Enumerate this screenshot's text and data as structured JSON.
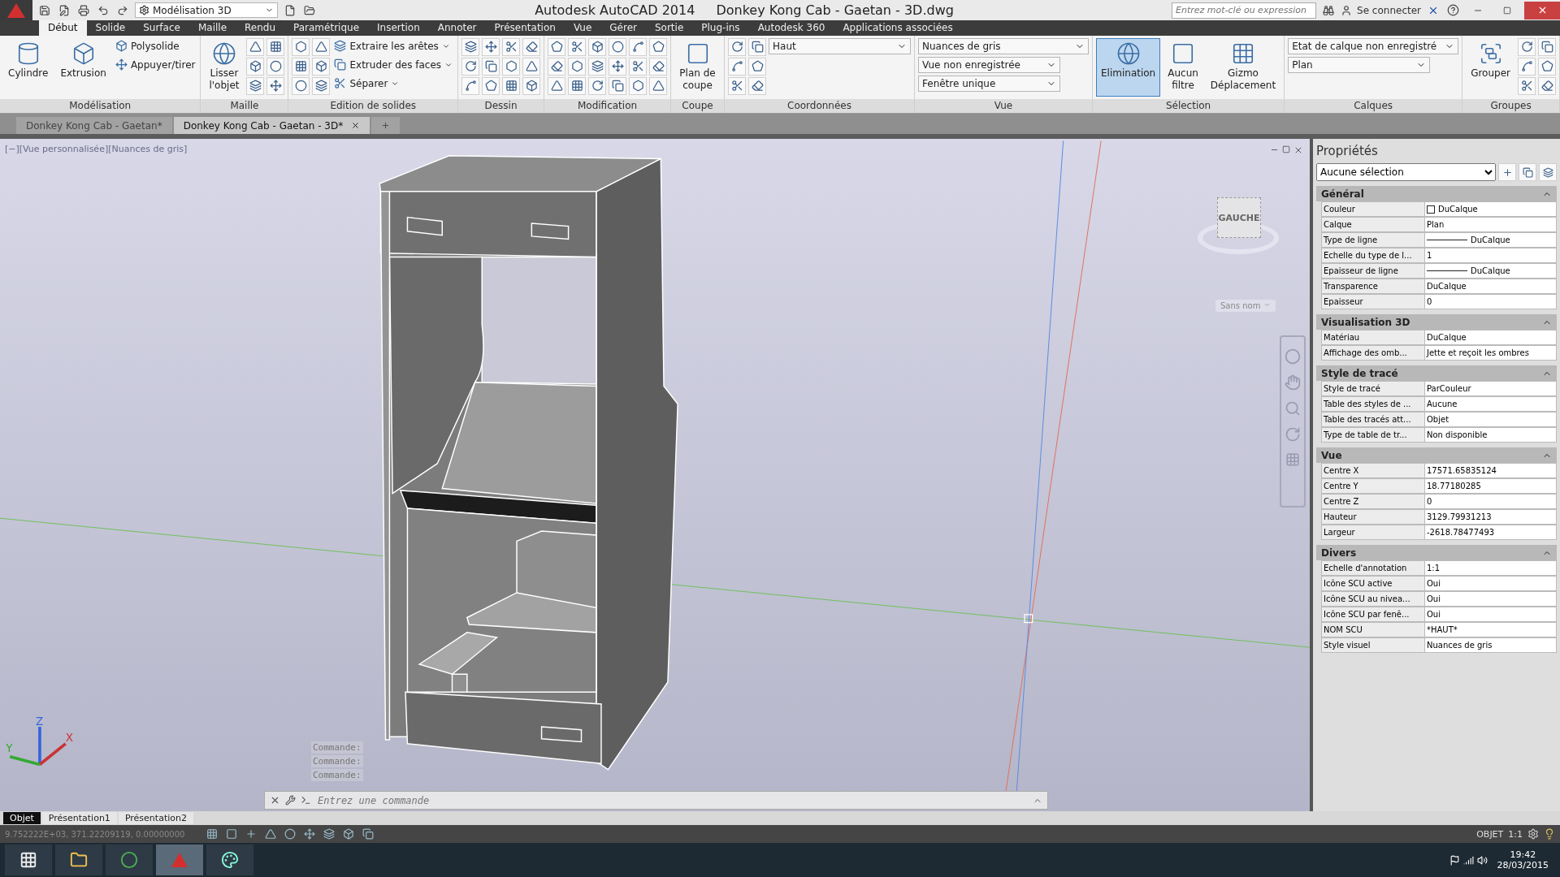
{
  "title_bar": {
    "workspace": "Modélisation 3D",
    "app_name": "Autodesk AutoCAD 2014",
    "file_name": "Donkey Kong Cab - Gaetan - 3D.dwg",
    "search": {
      "placeholder": "Entrez mot-clé ou expression"
    },
    "sign_in": "Se connecter"
  },
  "ribbon_tabs": [
    {
      "label": "Début",
      "selected": true
    },
    {
      "label": "Solide",
      "selected": false
    },
    {
      "label": "Surface",
      "selected": false
    },
    {
      "label": "Maille",
      "selected": false
    },
    {
      "label": "Rendu",
      "selected": false
    },
    {
      "label": "Paramétrique",
      "selected": false
    },
    {
      "label": "Insertion",
      "selected": false
    },
    {
      "label": "Annoter",
      "selected": false
    },
    {
      "label": "Présentation",
      "selected": false
    },
    {
      "label": "Vue",
      "selected": false
    },
    {
      "label": "Gérer",
      "selected": false
    },
    {
      "label": "Sortie",
      "selected": false
    },
    {
      "label": "Plug-ins",
      "selected": false
    },
    {
      "label": "Autodesk 360",
      "selected": false
    },
    {
      "label": "Applications associées",
      "selected": false
    }
  ],
  "ribbon_panels": [
    {
      "title": "Modélisation",
      "tools": [
        {
          "kind": "large",
          "label": "Cylindre",
          "selected": false
        },
        {
          "kind": "large",
          "label": "Extrusion",
          "selected": false
        },
        {
          "kind": "stack",
          "items": [
            {
              "label": "Polysolide",
              "menu": false
            },
            {
              "label": "Appuyer/tirer",
              "menu": false
            }
          ]
        }
      ]
    },
    {
      "title": "Maille",
      "tools": [
        {
          "kind": "large",
          "label": "Lisser l'objet",
          "selected": false
        },
        {
          "kind": "icons"
        }
      ]
    },
    {
      "title": "Edition de solides",
      "tools": [
        {
          "kind": "icons"
        },
        {
          "kind": "stack",
          "items": [
            {
              "label": "Extraire les arêtes",
              "menu": true
            },
            {
              "label": "Extruder des faces",
              "menu": true
            },
            {
              "label": "Séparer",
              "menu": true
            }
          ]
        }
      ]
    },
    {
      "title": "Dessin",
      "tools": [
        {
          "kind": "icons"
        },
        {
          "kind": "icons"
        }
      ]
    },
    {
      "title": "Modification",
      "tools": [
        {
          "kind": "icons"
        },
        {
          "kind": "icons"
        },
        {
          "kind": "icons"
        }
      ]
    },
    {
      "title": "Coupe",
      "tools": [
        {
          "kind": "large",
          "label": "Plan de coupe",
          "selected": false
        }
      ]
    },
    {
      "title": "Coordonnées",
      "tools": [
        {
          "kind": "icons"
        },
        {
          "kind": "combo-stack",
          "items": [
            {
              "label": "Haut"
            }
          ]
        }
      ]
    },
    {
      "title": "Vue",
      "tools": [
        {
          "kind": "combo-stack",
          "items": [
            {
              "label": "Nuances de gris"
            },
            {
              "label": "Vue non enregistrée"
            },
            {
              "label": "Fenêtre unique"
            }
          ]
        }
      ]
    },
    {
      "title": "Sélection",
      "tools": [
        {
          "kind": "large",
          "label": "Elimination",
          "selected": true
        },
        {
          "kind": "large",
          "label": "Aucun filtre",
          "selected": false
        },
        {
          "kind": "large",
          "label": "Gizmo Déplacement",
          "selected": false
        }
      ]
    },
    {
      "title": "Calques",
      "tools": [
        {
          "kind": "combo-stack",
          "items": [
            {
              "label": "Etat de calque non enregistré"
            },
            {
              "label": "Plan"
            }
          ]
        }
      ]
    },
    {
      "title": "Groupes",
      "tools": [
        {
          "kind": "large",
          "label": "Grouper",
          "selected": false
        },
        {
          "kind": "icons"
        }
      ]
    }
  ],
  "document_tabs": [
    {
      "label": "Donkey Kong Cab - Gaetan*",
      "selected": false
    },
    {
      "label": "Donkey Kong Cab - Gaetan - 3D*",
      "selected": true
    }
  ],
  "viewport": {
    "label": "[−][Vue personnalisée][Nuances de gris]",
    "viewcube_face": "GAUCHE",
    "view_name": "Sans nom",
    "ucs_labels": [
      "Z",
      "X",
      "Y"
    ],
    "command_history": [
      "Commande:",
      "Commande:",
      "Commande:"
    ],
    "command_input": {
      "placeholder": "Entrez une commande"
    }
  },
  "properties": {
    "title": "Propriétés",
    "selection": "Aucune sélection",
    "sections": [
      {
        "title": "Général",
        "expanded": true,
        "rows": [
          {
            "kind": "color",
            "label": "Couleur",
            "value": "DuCalque"
          },
          {
            "kind": "text",
            "label": "Calque",
            "value": "Plan"
          },
          {
            "kind": "linetype",
            "label": "Type de ligne",
            "value": "DuCalque"
          },
          {
            "kind": "text",
            "label": "Echelle du type de l...",
            "value": "1"
          },
          {
            "kind": "linetype",
            "label": "Epaisseur de ligne",
            "value": "DuCalque"
          },
          {
            "kind": "text",
            "label": "Transparence",
            "value": "DuCalque"
          },
          {
            "kind": "text",
            "label": "Epaisseur",
            "value": "0"
          }
        ]
      },
      {
        "title": "Visualisation 3D",
        "expanded": true,
        "rows": [
          {
            "kind": "text",
            "label": "Matériau",
            "value": "DuCalque"
          },
          {
            "kind": "text",
            "label": "Affichage des omb...",
            "value": "Jette et reçoit les ombres"
          }
        ]
      },
      {
        "title": "Style de tracé",
        "expanded": true,
        "rows": [
          {
            "kind": "text",
            "label": "Style de tracé",
            "value": "ParCouleur"
          },
          {
            "kind": "text",
            "label": "Table des styles de ...",
            "value": "Aucune"
          },
          {
            "kind": "text",
            "label": "Table des tracés att...",
            "value": "Objet"
          },
          {
            "kind": "text",
            "label": "Type de table de tr...",
            "value": "Non disponible"
          }
        ]
      },
      {
        "title": "Vue",
        "expanded": true,
        "rows": [
          {
            "kind": "text",
            "label": "Centre X",
            "value": "17571.65835124"
          },
          {
            "kind": "text",
            "label": "Centre Y",
            "value": "18.77180285"
          },
          {
            "kind": "text",
            "label": "Centre Z",
            "value": "0"
          },
          {
            "kind": "text",
            "label": "Hauteur",
            "value": "3129.79931213"
          },
          {
            "kind": "text",
            "label": "Largeur",
            "value": "-2618.78477493"
          }
        ]
      },
      {
        "title": "Divers",
        "expanded": true,
        "rows": [
          {
            "kind": "text",
            "label": "Echelle d'annotation",
            "value": "1:1"
          },
          {
            "kind": "text",
            "label": "Icône SCU active",
            "value": "Oui"
          },
          {
            "kind": "text",
            "label": "Icône SCU au nivea...",
            "value": "Oui"
          },
          {
            "kind": "text",
            "label": "Icône SCU par fenê...",
            "value": "Oui"
          },
          {
            "kind": "text",
            "label": "NOM SCU",
            "value": "*HAUT*"
          },
          {
            "kind": "text",
            "label": "Style visuel",
            "value": "Nuances de gris"
          }
        ]
      }
    ]
  },
  "layout_tabs": [
    {
      "label": "Objet",
      "selected": true
    },
    {
      "label": "Présentation1",
      "selected": false
    },
    {
      "label": "Présentation2",
      "selected": false
    }
  ],
  "status_bar": {
    "coordinates": "9.752222E+03, 371.22209119, 0.00000000",
    "space": "OBJET",
    "scale": "1:1"
  },
  "taskbar": {
    "time": "19:42",
    "date": "28/03/2015"
  }
}
